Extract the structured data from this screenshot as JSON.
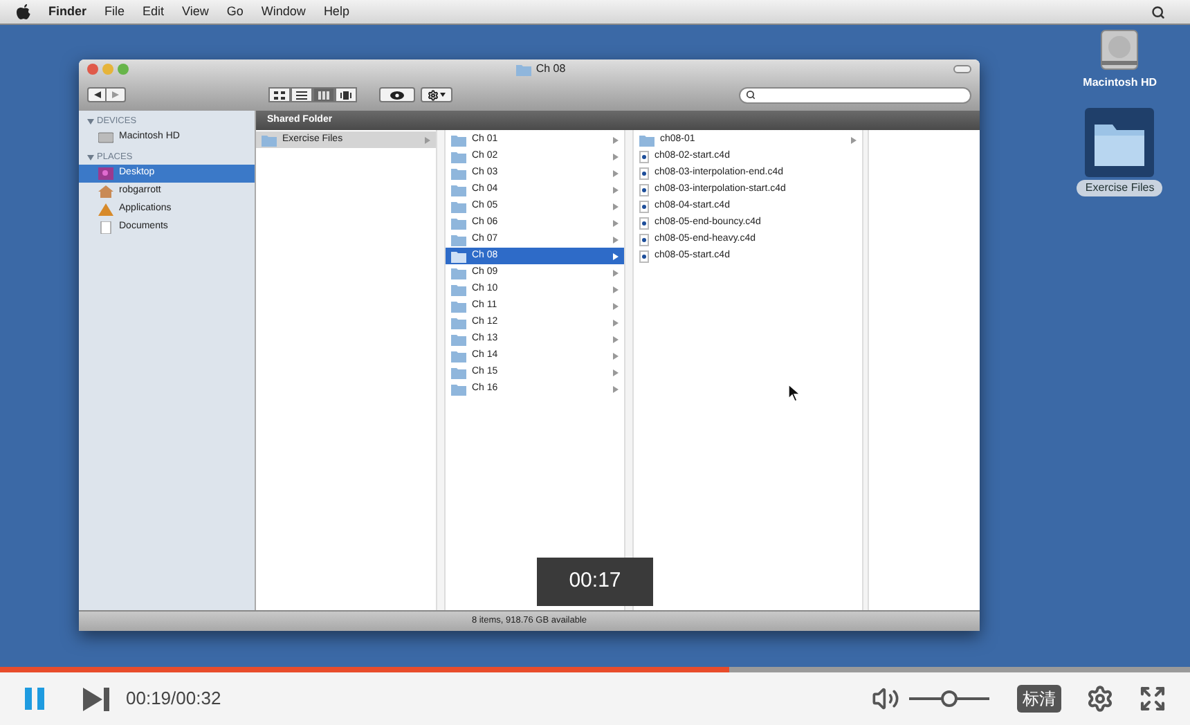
{
  "menu_bar": {
    "app_name": "Finder",
    "menus": [
      "File",
      "Edit",
      "View",
      "Go",
      "Window",
      "Help"
    ]
  },
  "desktop_icons": [
    {
      "kind": "drive",
      "label": "Macintosh HD",
      "selected": false
    },
    {
      "kind": "folder",
      "label": "Exercise Files",
      "selected": true
    }
  ],
  "finder": {
    "title": "Ch 08",
    "views": [
      {
        "kind": "icons",
        "selected": false
      },
      {
        "kind": "list",
        "selected": false
      },
      {
        "kind": "columns",
        "selected": true
      },
      {
        "kind": "coverflow",
        "selected": false
      }
    ],
    "path_header": "Shared Folder",
    "sidebar": [
      {
        "heading": "DEVICES",
        "items": [
          {
            "kind": "drive",
            "label": "Macintosh HD",
            "selected": false
          }
        ]
      },
      {
        "heading": "PLACES",
        "items": [
          {
            "kind": "desktop",
            "label": "Desktop",
            "selected": true
          },
          {
            "kind": "home",
            "label": "robgarrott",
            "selected": false
          },
          {
            "kind": "applications",
            "label": "Applications",
            "selected": false
          },
          {
            "kind": "documents",
            "label": "Documents",
            "selected": false
          }
        ]
      }
    ],
    "columns": [
      {
        "focused": false,
        "items": [
          {
            "kind": "folder",
            "label": "Exercise Files",
            "selected": true
          }
        ]
      },
      {
        "focused": true,
        "items": [
          {
            "kind": "folder",
            "label": "Ch 01",
            "selected": false
          },
          {
            "kind": "folder",
            "label": "Ch 02",
            "selected": false
          },
          {
            "kind": "folder",
            "label": "Ch 03",
            "selected": false
          },
          {
            "kind": "folder",
            "label": "Ch 04",
            "selected": false
          },
          {
            "kind": "folder",
            "label": "Ch 05",
            "selected": false
          },
          {
            "kind": "folder",
            "label": "Ch 06",
            "selected": false
          },
          {
            "kind": "folder",
            "label": "Ch 07",
            "selected": false
          },
          {
            "kind": "folder",
            "label": "Ch 08",
            "selected": true
          },
          {
            "kind": "folder",
            "label": "Ch 09",
            "selected": false
          },
          {
            "kind": "folder",
            "label": "Ch 10",
            "selected": false
          },
          {
            "kind": "folder",
            "label": "Ch 11",
            "selected": false
          },
          {
            "kind": "folder",
            "label": "Ch 12",
            "selected": false
          },
          {
            "kind": "folder",
            "label": "Ch 13",
            "selected": false
          },
          {
            "kind": "folder",
            "label": "Ch 14",
            "selected": false
          },
          {
            "kind": "folder",
            "label": "Ch 15",
            "selected": false
          },
          {
            "kind": "folder",
            "label": "Ch 16",
            "selected": false
          }
        ]
      },
      {
        "items": [
          {
            "kind": "folder",
            "label": "ch08-01",
            "selected": false
          },
          {
            "kind": "file",
            "label": "ch08-02-start.c4d",
            "selected": false
          },
          {
            "kind": "file",
            "label": "ch08-03-interpolation-end.c4d",
            "selected": false
          },
          {
            "kind": "file",
            "label": "ch08-03-interpolation-start.c4d",
            "selected": false
          },
          {
            "kind": "file",
            "label": "ch08-04-start.c4d",
            "selected": false
          },
          {
            "kind": "file",
            "label": "ch08-05-end-bouncy.c4d",
            "selected": false
          },
          {
            "kind": "file",
            "label": "ch08-05-end-heavy.c4d",
            "selected": false
          },
          {
            "kind": "file",
            "label": "ch08-05-start.c4d",
            "selected": false
          }
        ]
      }
    ],
    "status": "8 items, 918.76 GB available"
  },
  "player": {
    "playing": true,
    "progress": {
      "level": 0.613
    },
    "hover_time": "00:17",
    "time": "00:19/00:32",
    "volume": {
      "level": 0.5
    },
    "quality": "标清"
  }
}
